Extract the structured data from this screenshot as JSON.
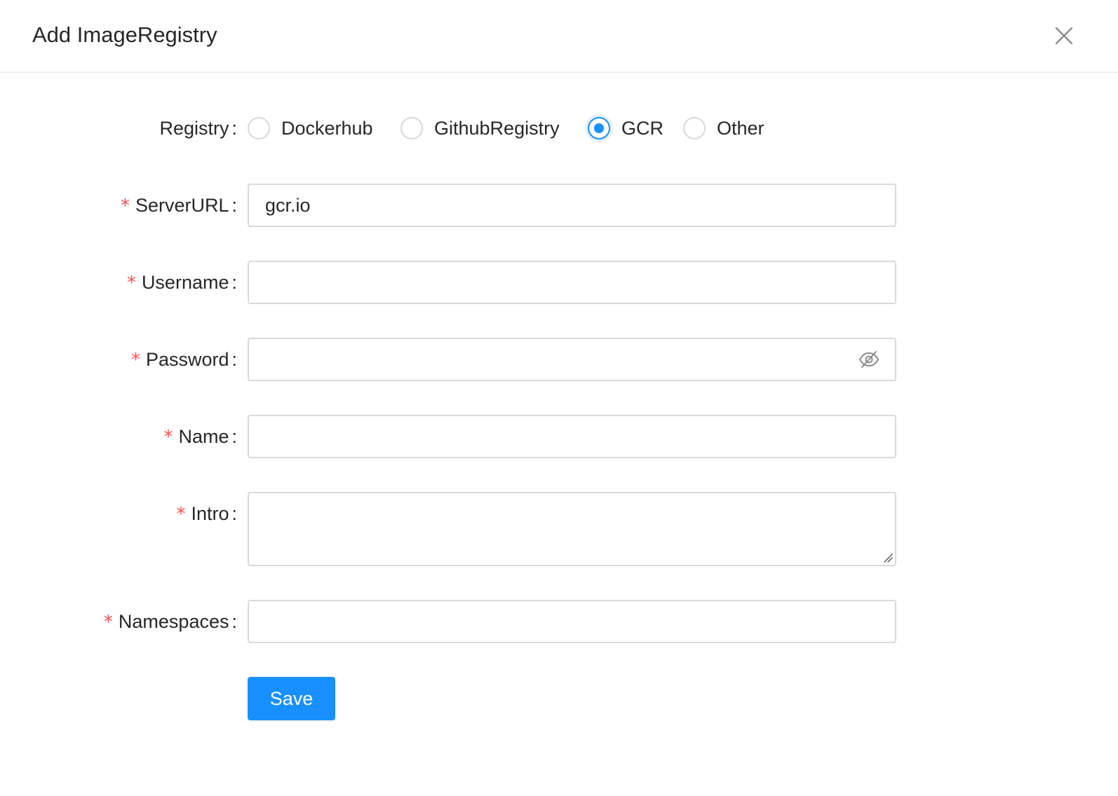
{
  "modal": {
    "title": "Add ImageRegistry",
    "close_icon": "close-icon"
  },
  "form": {
    "registry": {
      "label": "Registry",
      "options": [
        {
          "label": "Dockerhub",
          "checked": false
        },
        {
          "label": "GithubRegistry",
          "checked": false
        },
        {
          "label": "GCR",
          "checked": true
        },
        {
          "label": "Other",
          "checked": false
        }
      ]
    },
    "server_url": {
      "label": "ServerURL",
      "value": "gcr.io",
      "required": true
    },
    "username": {
      "label": "Username",
      "value": "",
      "required": true
    },
    "password": {
      "label": "Password",
      "value": "",
      "required": true,
      "icon": "eye-invisible-icon"
    },
    "name": {
      "label": "Name",
      "value": "",
      "required": true
    },
    "intro": {
      "label": "Intro",
      "value": "",
      "required": true
    },
    "namespaces": {
      "label": "Namespaces",
      "value": "",
      "required": true
    },
    "required_mark": "*",
    "colon": ":",
    "save_label": "Save"
  },
  "colors": {
    "primary": "#1890ff",
    "required": "#ff4d4f",
    "border": "#d9d9d9"
  }
}
